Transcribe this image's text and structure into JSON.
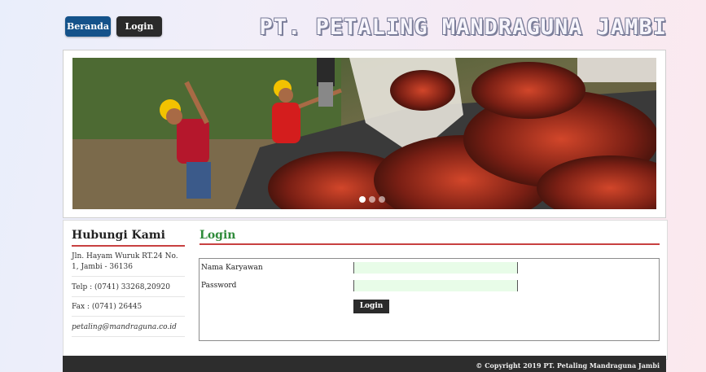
{
  "nav": {
    "home_label": "Beranda",
    "login_label": "Login"
  },
  "header": {
    "site_title": "PT. PETALING MANDRAGUNA JAMBI"
  },
  "banner": {
    "image_name": "palm-oil-harvest-photo",
    "dots": 3,
    "active_dot": 1
  },
  "sidebar": {
    "title": "Hubungi Kami",
    "address": "Jln. Hayam Wuruk RT.24 No. 1, Jambi - 36136",
    "phone": "Telp : (0741) 33268,20920",
    "fax": "Fax : (0741) 26445",
    "email": "petaling@mandraguna.co.id"
  },
  "login_form": {
    "title": "Login",
    "username_label": "Nama Karyawan",
    "username_value": "",
    "password_label": "Password",
    "password_value": "",
    "submit_label": "Login"
  },
  "footer": {
    "copyright": "© Copyright 2019 PT. Petaling Mandraguna Jambi"
  },
  "colors": {
    "home_button": "#14528a",
    "login_button": "#2a2a2a",
    "accent_line": "#c84141",
    "form_title": "#2f8b3a",
    "input_bg": "#e8fce8",
    "footer_bg": "#2d2d2d"
  }
}
